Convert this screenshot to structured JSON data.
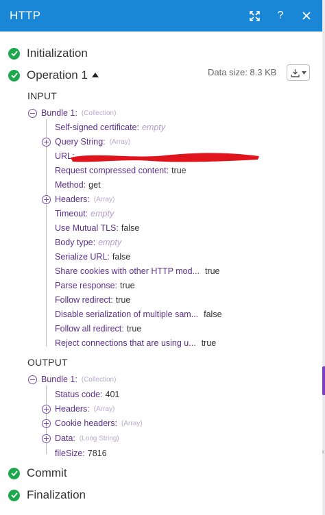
{
  "window": {
    "title": "HTTP"
  },
  "icons": {
    "expand": "expand-icon",
    "help": "help-icon",
    "close": "close-icon",
    "check": "check-circle-icon",
    "download": "download-icon"
  },
  "colors": {
    "header": "#1a86d6",
    "success": "#1ea84e",
    "key": "#5b2f8c",
    "accent": "#7c3fc1"
  },
  "steps": {
    "initialization": "Initialization",
    "operation": "Operation 1",
    "commit": "Commit",
    "finalization": "Finalization"
  },
  "operation": {
    "data_size": "Data size: 8.3 KB"
  },
  "input": {
    "heading": "INPUT",
    "bundle_label": "Bundle 1:",
    "bundle_type": "(Collection)",
    "fields": {
      "self_signed_cert": {
        "key": "Self-signed certificate:",
        "value": "empty"
      },
      "query_string": {
        "key": "Query String:",
        "type": "(Array)"
      },
      "url": {
        "key": "URL:"
      },
      "compressed": {
        "key": "Request compressed content:",
        "value": "true"
      },
      "method": {
        "key": "Method:",
        "value": "get"
      },
      "headers": {
        "key": "Headers:",
        "type": "(Array)"
      },
      "timeout": {
        "key": "Timeout:",
        "value": "empty"
      },
      "mutual_tls": {
        "key": "Use Mutual TLS:",
        "value": "false"
      },
      "body_type": {
        "key": "Body type:",
        "value": "empty"
      },
      "serialize_url": {
        "key": "Serialize URL:",
        "value": "false"
      },
      "share_cookies": {
        "key": "Share cookies with other HTTP mod...",
        "value": "true"
      },
      "parse_response": {
        "key": "Parse response:",
        "value": "true"
      },
      "follow_redirect": {
        "key": "Follow redirect:",
        "value": "true"
      },
      "disable_serialization": {
        "key": "Disable serialization of multiple sam...",
        "value": "false"
      },
      "follow_all_redirect": {
        "key": "Follow all redirect:",
        "value": "true"
      },
      "reject_connections": {
        "key": "Reject connections that are using u...",
        "value": "true"
      }
    }
  },
  "output": {
    "heading": "OUTPUT",
    "bundle_label": "Bundle 1:",
    "bundle_type": "(Collection)",
    "fields": {
      "status_code": {
        "key": "Status code:",
        "value": "401"
      },
      "headers": {
        "key": "Headers:",
        "type": "(Array)"
      },
      "cookie_headers": {
        "key": "Cookie headers:",
        "type": "(Array)"
      },
      "data": {
        "key": "Data:",
        "type": "(Long String)"
      },
      "file_size": {
        "key": "fileSize:",
        "value": "7816"
      }
    }
  }
}
